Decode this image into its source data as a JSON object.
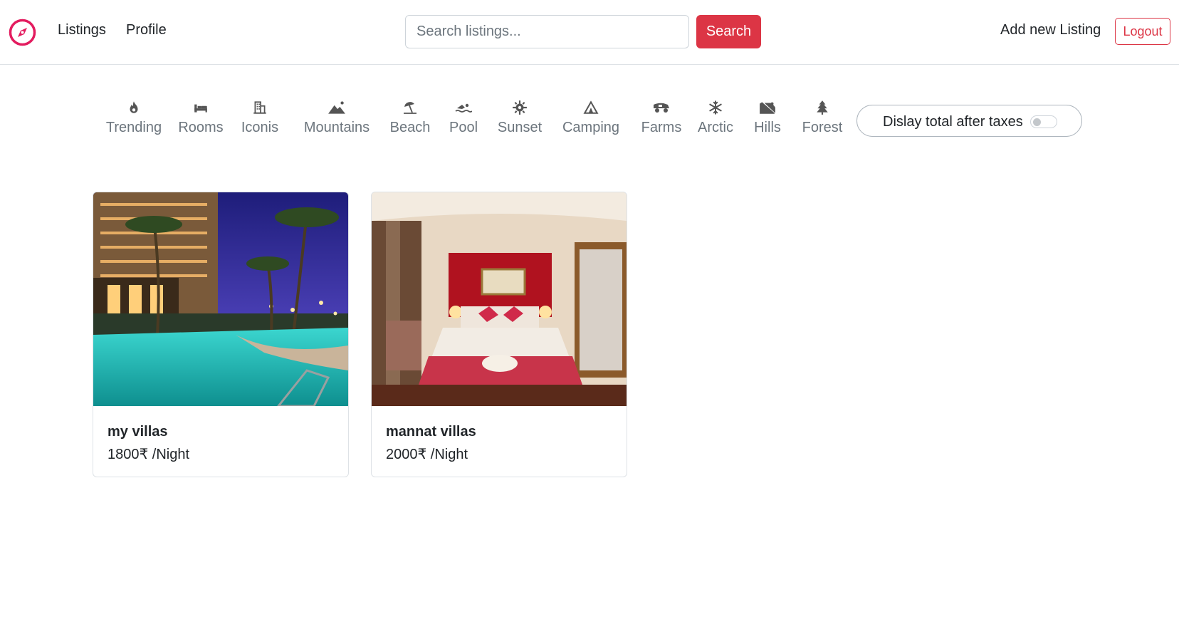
{
  "navbar": {
    "brand_icon": "compass-icon",
    "links": [
      "Listings",
      "Profile"
    ],
    "search": {
      "placeholder": "Search listings...",
      "button_label": "Search"
    },
    "add_listing_label": "Add new Listing",
    "logout_label": "Logout",
    "accent_color": "#dc3545"
  },
  "filters": [
    {
      "label": "Trending",
      "icon": "fire-icon"
    },
    {
      "label": "Rooms",
      "icon": "bed-icon"
    },
    {
      "label": "Iconis",
      "icon": "building-icon"
    },
    {
      "label": "Mountains",
      "icon": "mountain-icon"
    },
    {
      "label": "Beach",
      "icon": "umbrella-beach-icon"
    },
    {
      "label": "Pool",
      "icon": "swimmer-icon"
    },
    {
      "label": "Sunset",
      "icon": "sun-gear-icon"
    },
    {
      "label": "Camping",
      "icon": "tent-icon"
    },
    {
      "label": "Farms",
      "icon": "tractor-icon"
    },
    {
      "label": "Arctic",
      "icon": "snowflake-icon"
    },
    {
      "label": "Hills",
      "icon": "hill-icon"
    },
    {
      "label": "Forest",
      "icon": "tree-icon"
    }
  ],
  "tax_toggle": {
    "label": "Dislay total after taxes",
    "enabled": false
  },
  "listings": [
    {
      "title": "my villas",
      "price": "1800₹ /Night",
      "image": "resort-pool-photo"
    },
    {
      "title": "mannat villas",
      "price": "2000₹ /Night",
      "image": "hotel-bedroom-photo"
    }
  ]
}
